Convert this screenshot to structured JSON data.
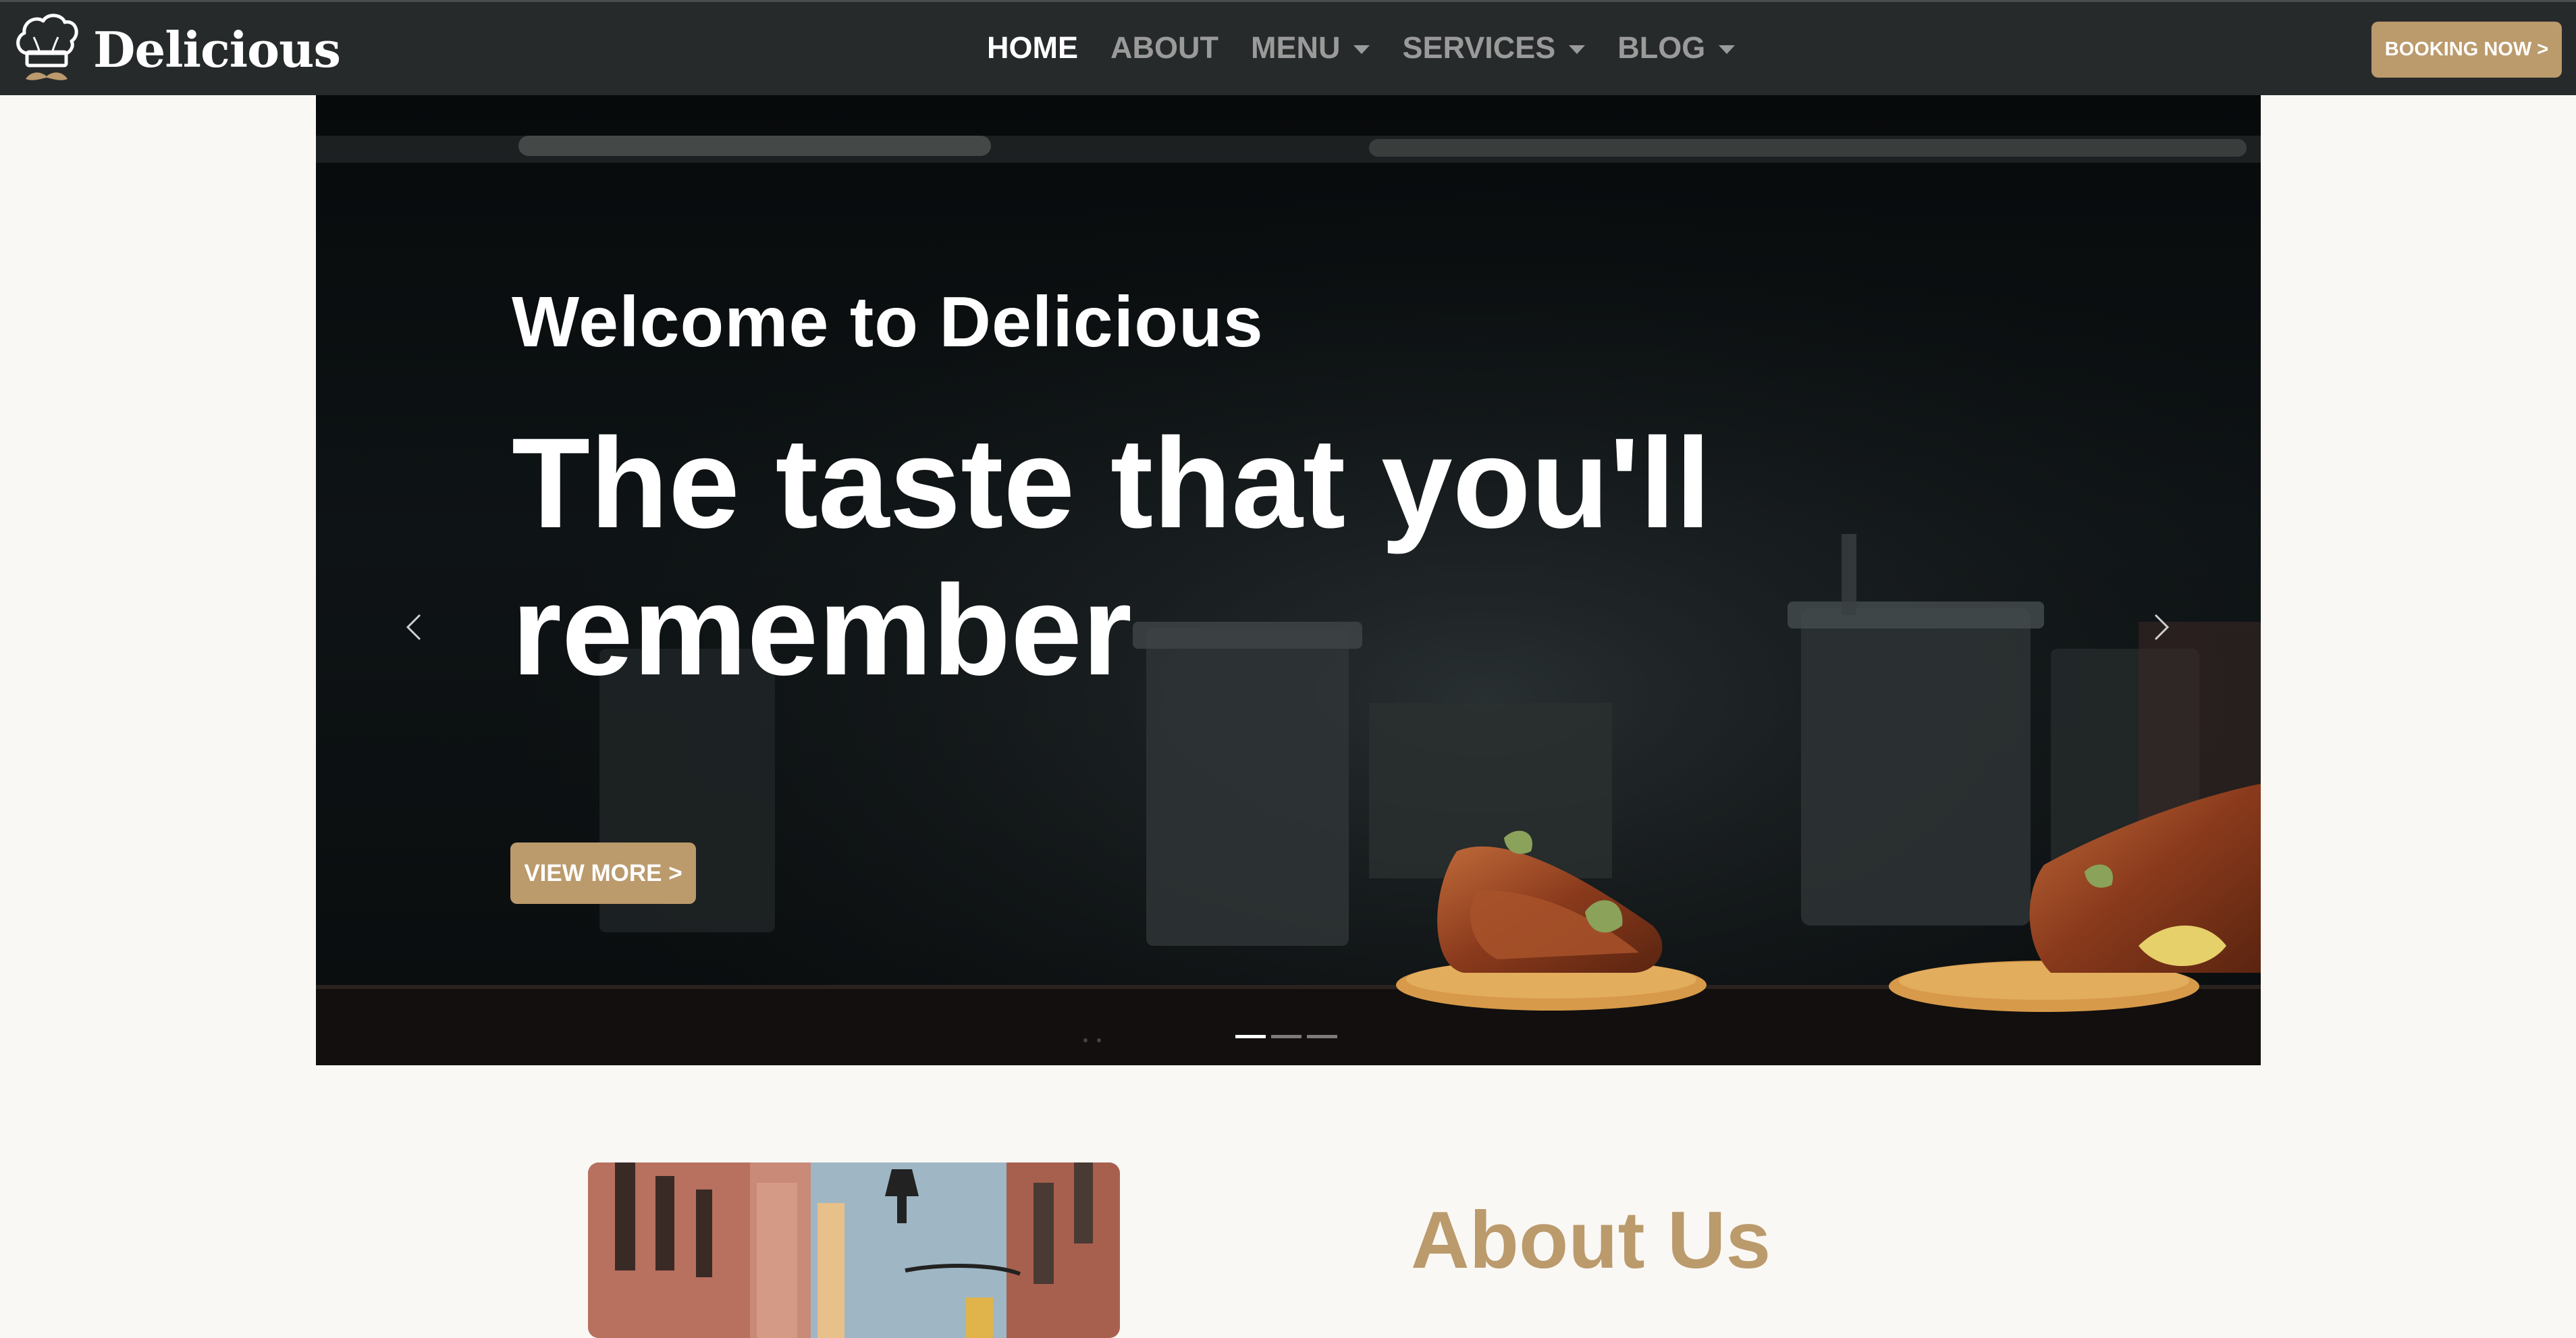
{
  "brand": {
    "name": "Delicious",
    "icon": "chef-hat-mustache-icon"
  },
  "nav": {
    "items": [
      {
        "label": "HOME",
        "active": true,
        "dropdown": false
      },
      {
        "label": "ABOUT",
        "active": false,
        "dropdown": false
      },
      {
        "label": "MENU",
        "active": false,
        "dropdown": true
      },
      {
        "label": "SERVICES",
        "active": false,
        "dropdown": true
      },
      {
        "label": "BLOG",
        "active": false,
        "dropdown": true
      }
    ],
    "booking_label": "BOOKING NOW >"
  },
  "hero": {
    "welcome": "Welcome to Delicious",
    "title": "The taste that you'll remember",
    "button_label": "VIEW MORE >",
    "prev_icon": "chevron-left-icon",
    "next_icon": "chevron-right-icon",
    "slide_count": 3,
    "active_slide": 1
  },
  "about": {
    "title": "About Us"
  },
  "colors": {
    "navbar_bg": "#262a2b",
    "accent": "#bb9a6c",
    "page_bg": "#faf8f4",
    "nav_inactive": "#9a9a9a",
    "nav_active": "#ffffff"
  }
}
